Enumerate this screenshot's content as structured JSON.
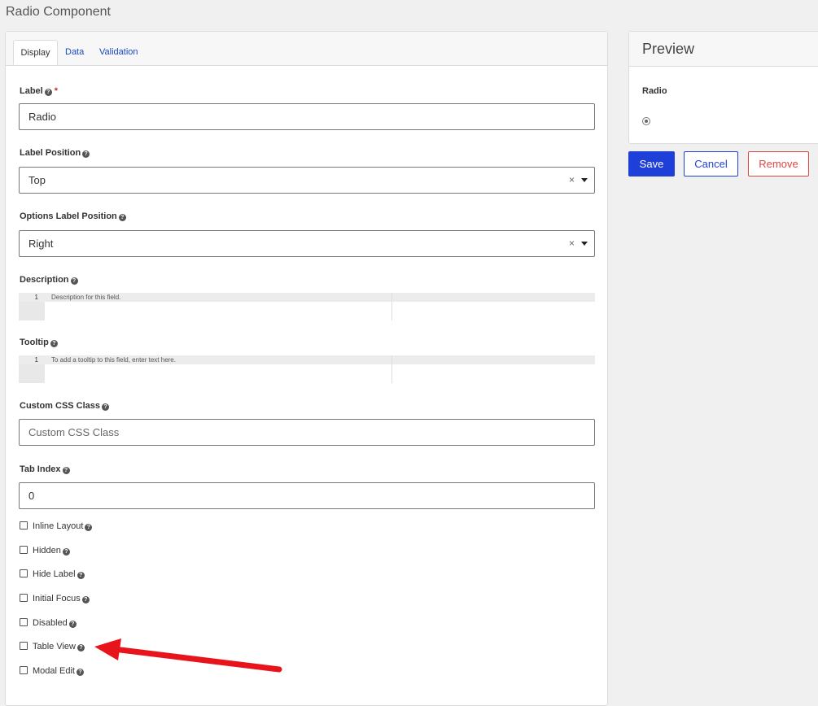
{
  "page": {
    "title": "Radio Component"
  },
  "tabs": [
    {
      "label": "Display"
    },
    {
      "label": "Data"
    },
    {
      "label": "Validation"
    }
  ],
  "form": {
    "label": {
      "title": "Label",
      "required_mark": "*",
      "value": "Radio"
    },
    "label_position": {
      "title": "Label Position",
      "value": "Top",
      "clear": "×"
    },
    "options_label_position": {
      "title": "Options Label Position",
      "value": "Right",
      "clear": "×"
    },
    "description": {
      "title": "Description",
      "line_no": "1",
      "text": "Description for this field."
    },
    "tooltip": {
      "title": "Tooltip",
      "line_no": "1",
      "text": "To add a tooltip to this field, enter text here."
    },
    "custom_css": {
      "title": "Custom CSS Class",
      "placeholder": "Custom CSS Class"
    },
    "tab_index": {
      "title": "Tab Index",
      "value": "0"
    },
    "checkboxes": [
      {
        "label": "Inline Layout"
      },
      {
        "label": "Hidden"
      },
      {
        "label": "Hide Label"
      },
      {
        "label": "Initial Focus"
      },
      {
        "label": "Disabled"
      },
      {
        "label": "Table View"
      },
      {
        "label": "Modal Edit"
      }
    ]
  },
  "preview": {
    "title": "Preview",
    "field_label": "Radio"
  },
  "buttons": {
    "save": "Save",
    "cancel": "Cancel",
    "remove": "Remove"
  },
  "help_icon": "question-circle-icon",
  "colors": {
    "primary": "#1f3fd9",
    "danger": "#dd4444",
    "annotation_arrow": "#e8141c"
  }
}
